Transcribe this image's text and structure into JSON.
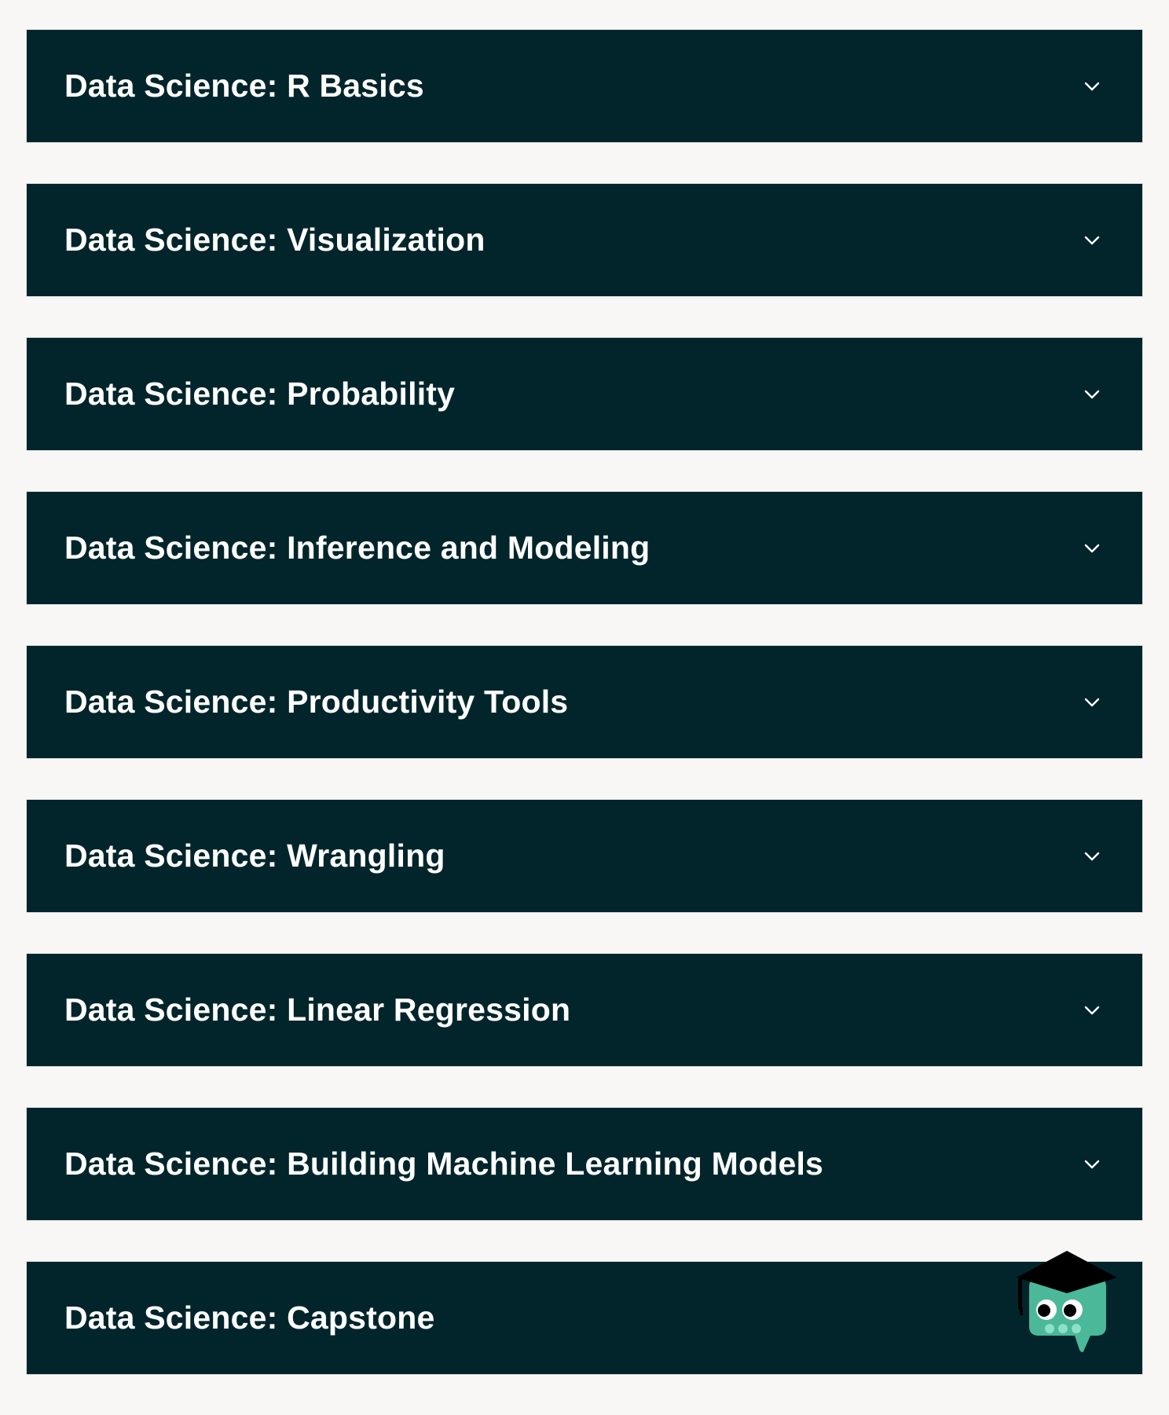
{
  "courses": [
    {
      "title": "Data Science: R Basics"
    },
    {
      "title": "Data Science: Visualization"
    },
    {
      "title": "Data Science: Probability"
    },
    {
      "title": "Data Science: Inference and Modeling"
    },
    {
      "title": "Data Science: Productivity Tools"
    },
    {
      "title": "Data Science: Wrangling"
    },
    {
      "title": "Data Science: Linear Regression"
    },
    {
      "title": "Data Science: Building Machine Learning Models"
    },
    {
      "title": "Data Science: Capstone"
    }
  ],
  "icons": {
    "expand": "chevron-down-icon",
    "assistant": "chat-mascot-icon"
  },
  "colors": {
    "page_background": "#f8f7f6",
    "panel_background": "#02252b",
    "title_text": "#ffffff",
    "mascot_body": "#4bb89a",
    "mascot_cap": "#000000"
  }
}
